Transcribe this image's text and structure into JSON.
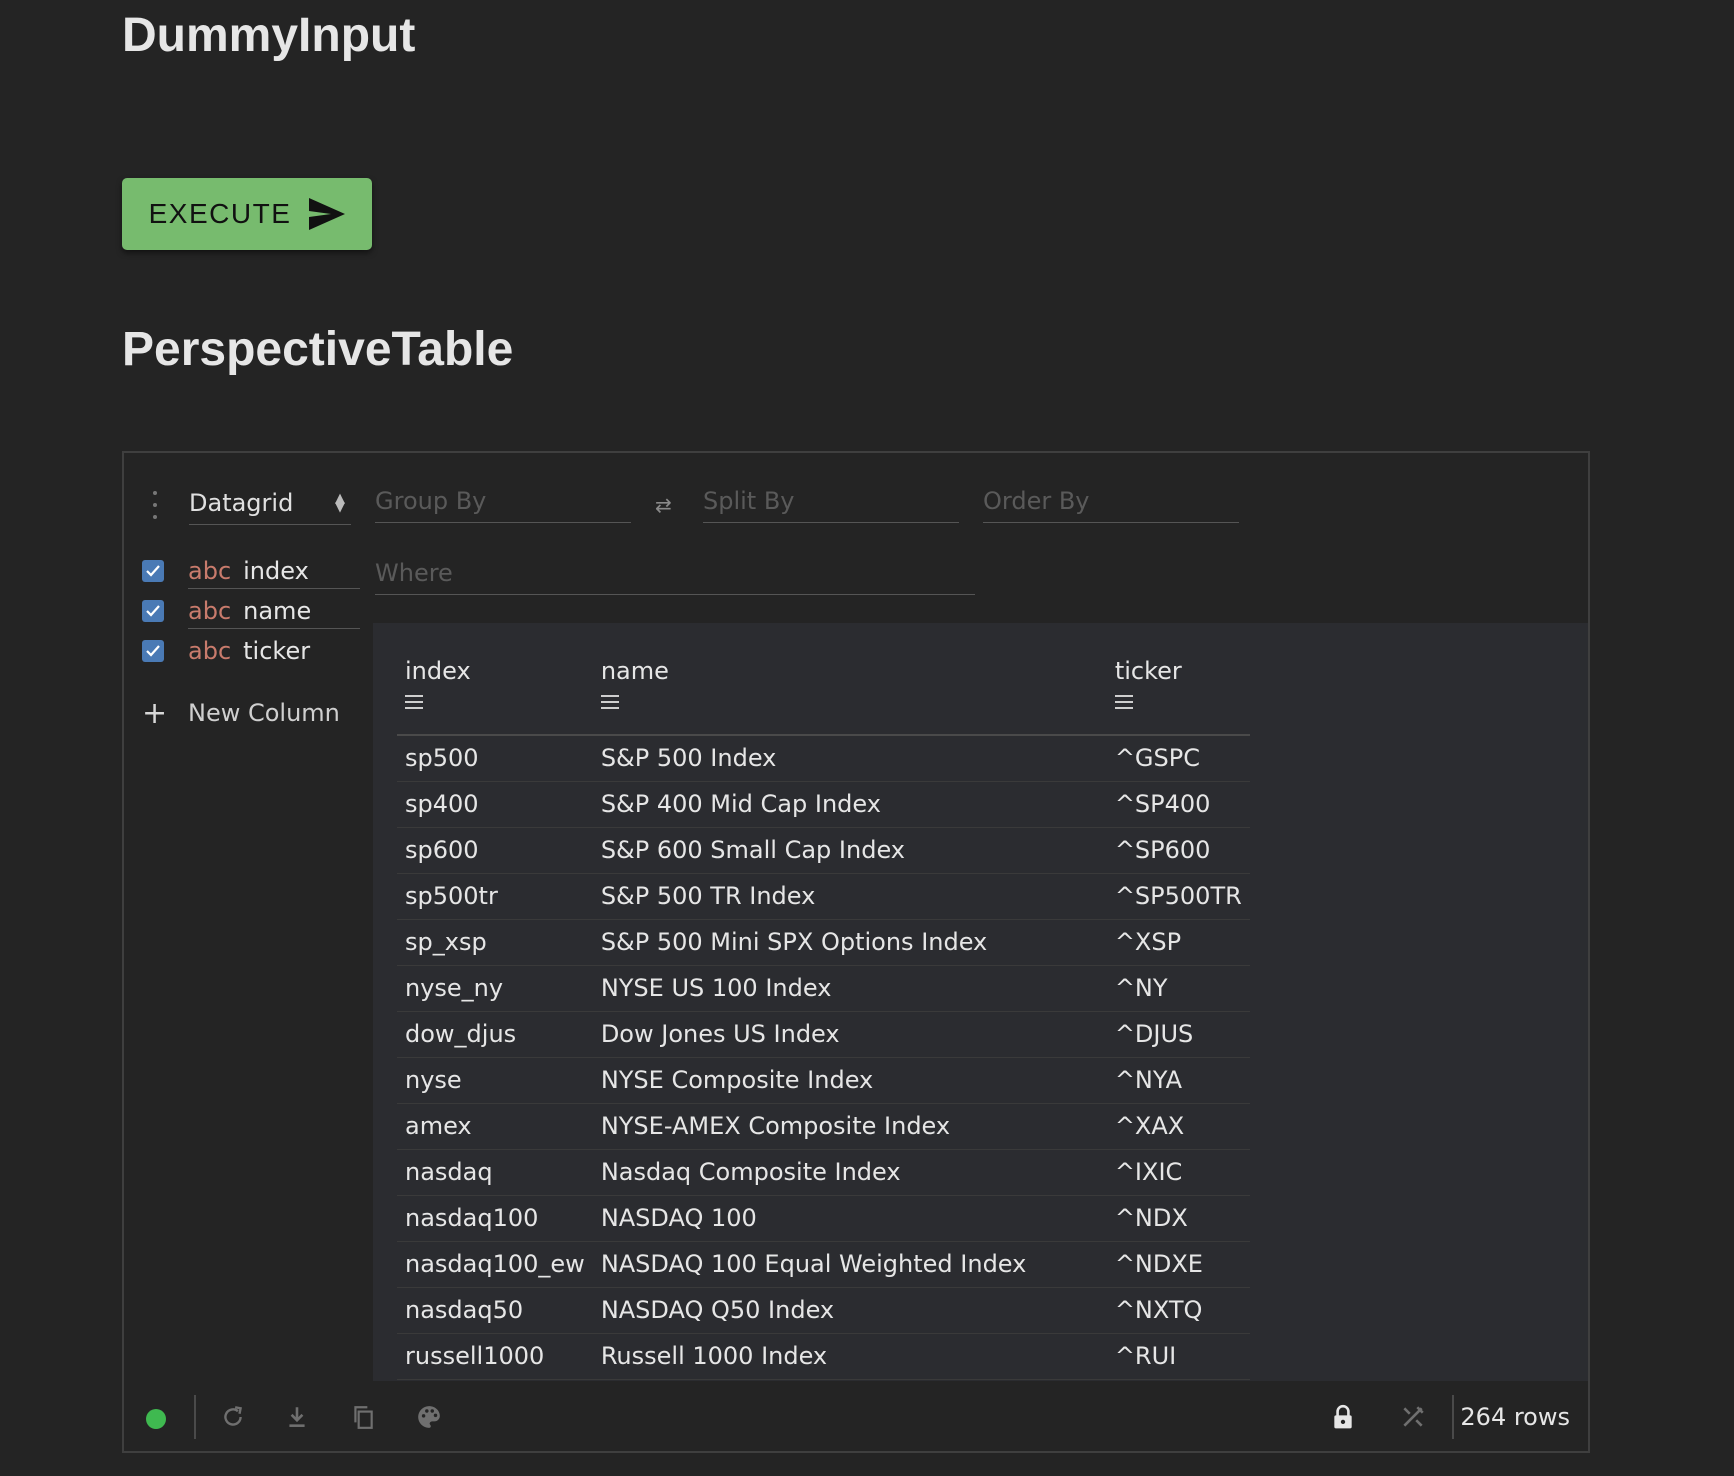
{
  "page": {
    "title": "DummyInput",
    "section_title": "PerspectiveTable",
    "execute_label": "EXECUTE"
  },
  "viewer": {
    "plugin": "Datagrid",
    "group_by_placeholder": "Group By",
    "split_by_placeholder": "Split By",
    "order_by_placeholder": "Order By",
    "where_placeholder": "Where",
    "columns": [
      {
        "type": "abc",
        "name": "index",
        "checked": true
      },
      {
        "type": "abc",
        "name": "name",
        "checked": true
      },
      {
        "type": "abc",
        "name": "ticker",
        "checked": true
      }
    ],
    "new_column_label": "New Column",
    "row_count": "264 rows"
  },
  "table": {
    "headers": [
      "index",
      "name",
      "ticker"
    ],
    "rows": [
      [
        "sp500",
        "S&P 500 Index",
        "^GSPC"
      ],
      [
        "sp400",
        "S&P 400 Mid Cap Index",
        "^SP400"
      ],
      [
        "sp600",
        "S&P 600 Small Cap Index",
        "^SP600"
      ],
      [
        "sp500tr",
        "S&P 500 TR Index",
        "^SP500TR"
      ],
      [
        "sp_xsp",
        "S&P 500 Mini SPX Options Index",
        "^XSP"
      ],
      [
        "nyse_ny",
        "NYSE US 100 Index",
        "^NY"
      ],
      [
        "dow_djus",
        "Dow Jones US Index",
        "^DJUS"
      ],
      [
        "nyse",
        "NYSE Composite Index",
        "^NYA"
      ],
      [
        "amex",
        "NYSE-AMEX Composite Index",
        "^XAX"
      ],
      [
        "nasdaq",
        "Nasdaq Composite Index",
        "^IXIC"
      ],
      [
        "nasdaq100",
        "NASDAQ 100",
        "^NDX"
      ],
      [
        "nasdaq100_ew",
        "NASDAQ 100 Equal Weighted Index",
        "^NDXE"
      ],
      [
        "nasdaq50",
        "NASDAQ Q50 Index",
        "^NXTQ"
      ],
      [
        "russell1000",
        "Russell 1000 Index",
        "^RUI"
      ]
    ]
  },
  "colors": {
    "background": "#242424",
    "execute_button": "#77bb6e",
    "checkbox": "#4a7ab5",
    "type_label": "#c97b6c",
    "status_ok": "#3fb950"
  },
  "icons": {
    "execute": "send-icon",
    "settings": "more-vertical-icon",
    "swap": "swap-icon",
    "column_menu": "menu-icon",
    "refresh": "refresh-icon",
    "download": "download-icon",
    "copy": "copy-icon",
    "theme": "palette-icon",
    "lock": "lock-icon",
    "free_scroll": "tools-icon"
  }
}
